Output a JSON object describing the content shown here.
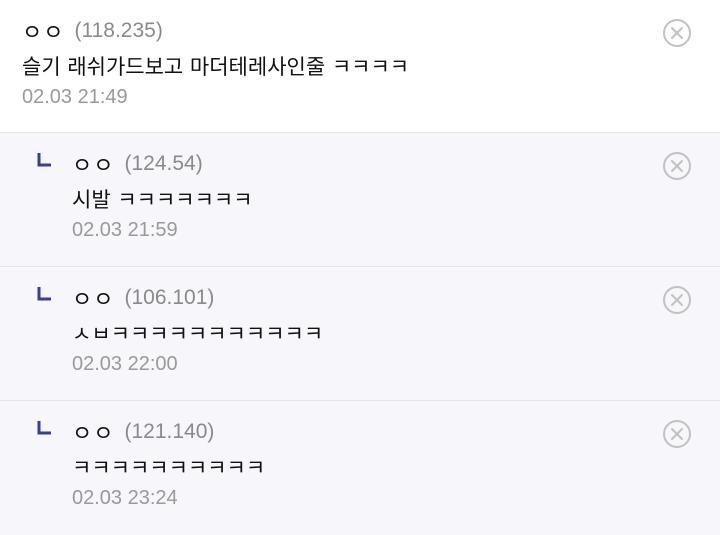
{
  "comments": [
    {
      "nick": "ㅇㅇ",
      "ip": "(118.235)",
      "text": "슬기 래쉬가드보고 마더테레사인줄 ㅋㅋㅋㅋ",
      "date": "02.03 21:49",
      "type": "top"
    },
    {
      "nick": "ㅇㅇ",
      "ip": "(124.54)",
      "text": "시발 ㅋㅋㅋㅋㅋㅋㅋ",
      "date": "02.03 21:59",
      "type": "reply"
    },
    {
      "nick": "ㅇㅇ",
      "ip": "(106.101)",
      "text": "ㅅㅂㅋㅋㅋㅋㅋㅋㅋㅋㅋㅋㅋ",
      "date": "02.03 22:00",
      "type": "reply"
    },
    {
      "nick": "ㅇㅇ",
      "ip": "(121.140)",
      "text": "ㅋㅋㅋㅋㅋㅋㅋㅋㅋㅋ",
      "date": "02.03 23:24",
      "type": "reply"
    }
  ],
  "icons": {
    "delete": "close-circle-icon",
    "reply_marker": "reply-arrow-icon"
  },
  "colors": {
    "reply_marker": "#3a3f8f",
    "delete_icon": "#c2c2c2",
    "reply_background": "#f6f6fb"
  }
}
